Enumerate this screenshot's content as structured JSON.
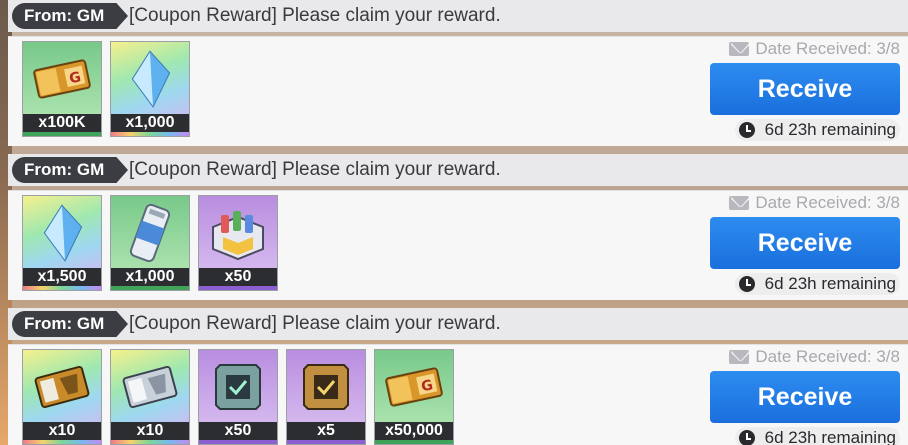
{
  "mails": [
    {
      "from": "From: GM",
      "subject": "[Coupon Reward] Please claim your reward.",
      "date": "Date Received: 3/8",
      "button": "Receive",
      "remaining": "6d 23h remaining",
      "rewards": [
        {
          "icon": "gold-ticket-icon",
          "qty": "x100K",
          "rarity": "green"
        },
        {
          "icon": "blue-crystal-icon",
          "qty": "x1,000",
          "rarity": "rainbow"
        }
      ]
    },
    {
      "from": "From: GM",
      "subject": "[Coupon Reward] Please claim your reward.",
      "date": "Date Received: 3/8",
      "button": "Receive",
      "remaining": "6d 23h remaining",
      "rewards": [
        {
          "icon": "blue-crystal-icon",
          "qty": "x1,500",
          "rarity": "rainbow"
        },
        {
          "icon": "energy-can-icon",
          "qty": "x1,000",
          "rarity": "green"
        },
        {
          "icon": "drink-crate-icon",
          "qty": "x50",
          "rarity": "purple"
        }
      ]
    },
    {
      "from": "From: GM",
      "subject": "[Coupon Reward] Please claim your reward.",
      "date": "Date Received: 3/8",
      "button": "Receive",
      "remaining": "6d 23h remaining",
      "rewards": [
        {
          "icon": "gold-ticket-icon",
          "qty": "x10",
          "rarity": "rainbow"
        },
        {
          "icon": "silver-ticket-icon",
          "qty": "x10",
          "rarity": "rainbow"
        },
        {
          "icon": "chip-frame-icon",
          "qty": "x50",
          "rarity": "purple"
        },
        {
          "icon": "chip-frame-icon",
          "qty": "x5",
          "rarity": "purple"
        },
        {
          "icon": "gold-ticket-icon",
          "qty": "x50,000",
          "rarity": "green"
        }
      ]
    }
  ]
}
